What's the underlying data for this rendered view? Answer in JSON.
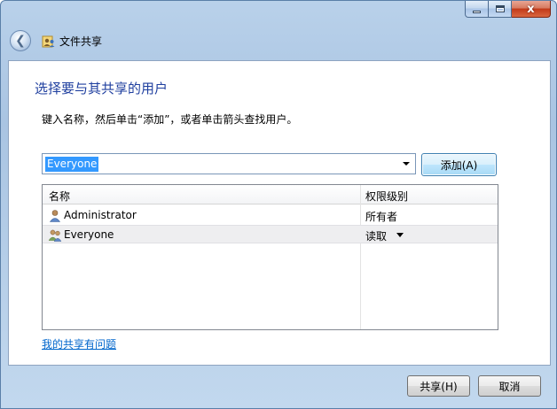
{
  "window": {
    "title": "文件共享",
    "caption": {
      "close_label": "x"
    }
  },
  "main": {
    "heading": "选择要与其共享的用户",
    "instruction": "键入名称，然后单击“添加”，或者单击箭头查找用户。",
    "name_combo": {
      "value": "Everyone"
    },
    "add_button_label": "添加(A)"
  },
  "list": {
    "columns": [
      "名称",
      "权限级别"
    ],
    "rows": [
      {
        "name": "Administrator",
        "permission": "所有者",
        "icon": "user-icon"
      },
      {
        "name": "Everyone",
        "permission": "读取",
        "icon": "group-icon",
        "has_dropdown": true
      }
    ]
  },
  "footer": {
    "help_link": "我的共享有问题",
    "share_button_label": "共享(H)",
    "cancel_button_label": "取消"
  },
  "colors": {
    "heading": "#1f3f9f",
    "link": "#0066cc",
    "selection": "#3399ff",
    "close_button": "#c2391a"
  }
}
